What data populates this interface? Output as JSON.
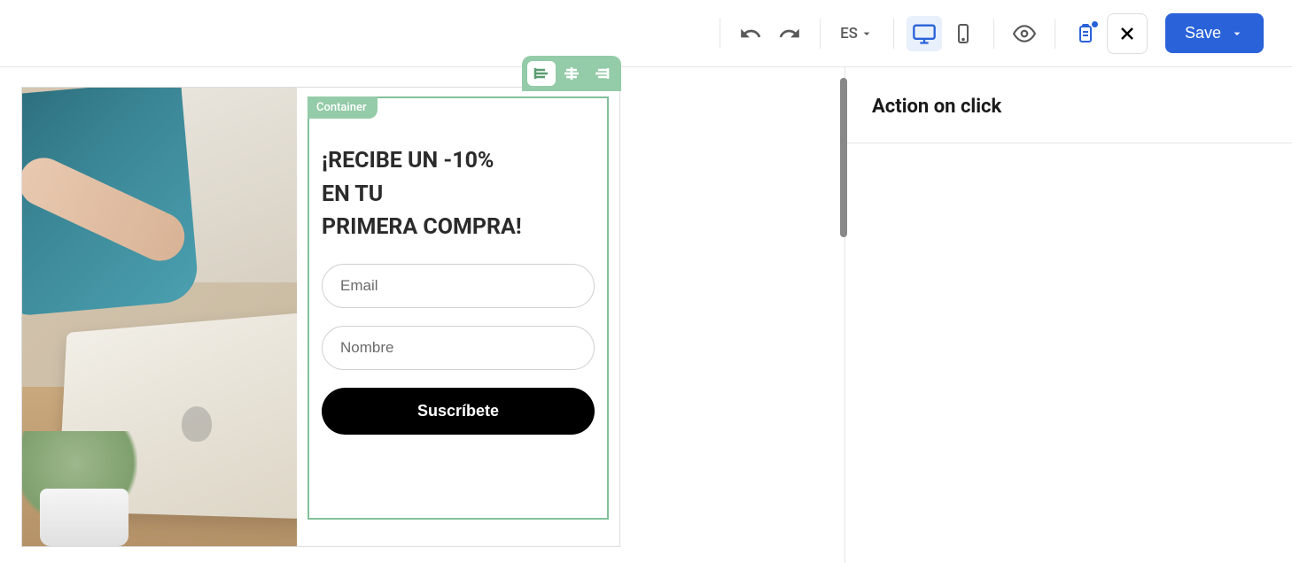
{
  "toolbar": {
    "language": "ES",
    "save_label": "Save"
  },
  "sidebar": {
    "title": "Action on click"
  },
  "editor": {
    "container_label": "Container",
    "heading_line1": "¡RECIBE UN -10%",
    "heading_line2": "EN TU",
    "heading_line3": "PRIMERA COMPRA!",
    "email_placeholder": "Email",
    "name_placeholder": "Nombre",
    "submit_label": "Suscríbete"
  },
  "icons": {
    "undo": "undo-icon",
    "redo": "redo-icon",
    "desktop": "desktop-icon",
    "mobile": "mobile-icon",
    "preview": "eye-icon",
    "clipboard": "clipboard-icon",
    "close": "close-icon",
    "chevron_down": "chevron-down-icon",
    "align_left": "align-left-icon",
    "align_center": "align-center-icon",
    "align_right": "align-right-icon"
  }
}
